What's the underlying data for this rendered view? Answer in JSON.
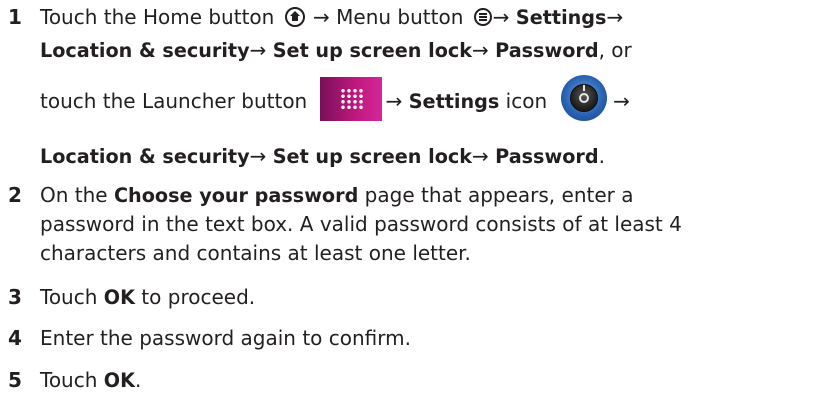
{
  "steps": [
    {
      "number": "1",
      "line1": {
        "t1": "Touch the Home button",
        "t2": "→ Menu button",
        "t3": "→ ",
        "b1": "Settings",
        "t4": "→"
      },
      "line2": {
        "b1": "Location & security",
        "t1": "→ ",
        "b2": "Set up screen lock",
        "t2": "→ ",
        "b3": "Password",
        "t3": ", or"
      },
      "line3": {
        "t1": "touch the Launcher button",
        "t2": "→ ",
        "b1": "Settings",
        "t3": " icon",
        "t4": "→"
      },
      "line4": {
        "b1": "Location & security",
        "t1": "→ ",
        "b2": "Set up screen lock",
        "t2": "→ ",
        "b3": "Password",
        "t3": "."
      }
    },
    {
      "number": "2",
      "line1": {
        "t1": "On the ",
        "b1": "Choose your password",
        "t2": " page that appears, enter a"
      },
      "line2": "password in the text box. A valid password consists of at least 4",
      "line3": "characters and contains at least one letter."
    },
    {
      "number": "3",
      "t1": "Touch ",
      "b1": "OK",
      "t2": " to proceed."
    },
    {
      "number": "4",
      "t1": "Enter the password again to confirm."
    },
    {
      "number": "5",
      "t1": "Touch ",
      "b1": "OK",
      "t2": "."
    }
  ],
  "icons": {
    "home": "home-icon",
    "menu": "menu-icon",
    "launcher": "launcher-grid-icon",
    "settings": "settings-dial-icon"
  },
  "colors": {
    "text": "#231f20",
    "launcher": "#c0197f",
    "settings": "#2a64b4"
  }
}
